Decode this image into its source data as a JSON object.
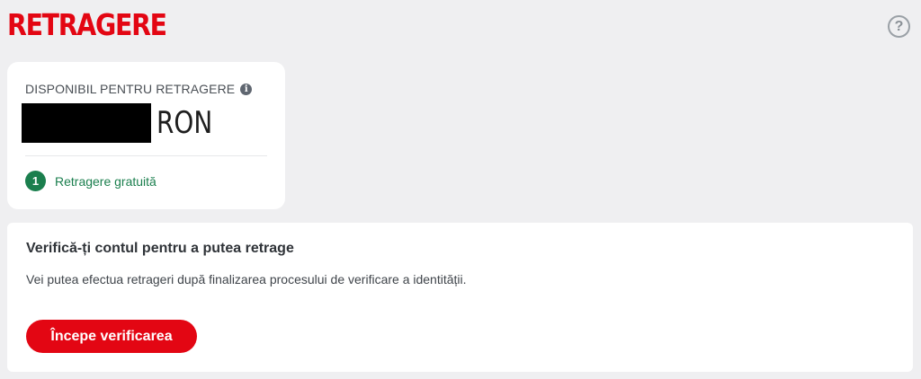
{
  "header": {
    "title": "RETRAGERE",
    "help_icon": "help-circle-icon",
    "help_glyph": "?"
  },
  "balance": {
    "label": "DISPONIBIL PENTRU RETRAGERE",
    "info_icon": "info-icon",
    "info_glyph": "i",
    "amount_redacted": true,
    "currency": "RON",
    "free_withdrawals_count": "1",
    "free_withdrawals_label": "Retragere gratuită"
  },
  "verification": {
    "heading": "Verifică-ți contul pentru a putea retrage",
    "description": "Vei putea efectua retrageri după finalizarea procesului de verificare a identității.",
    "button_label": "Începe verificarea"
  },
  "colors": {
    "brand_red": "#e30613",
    "success_green": "#1b7f4e",
    "page_background": "#efeff1"
  }
}
